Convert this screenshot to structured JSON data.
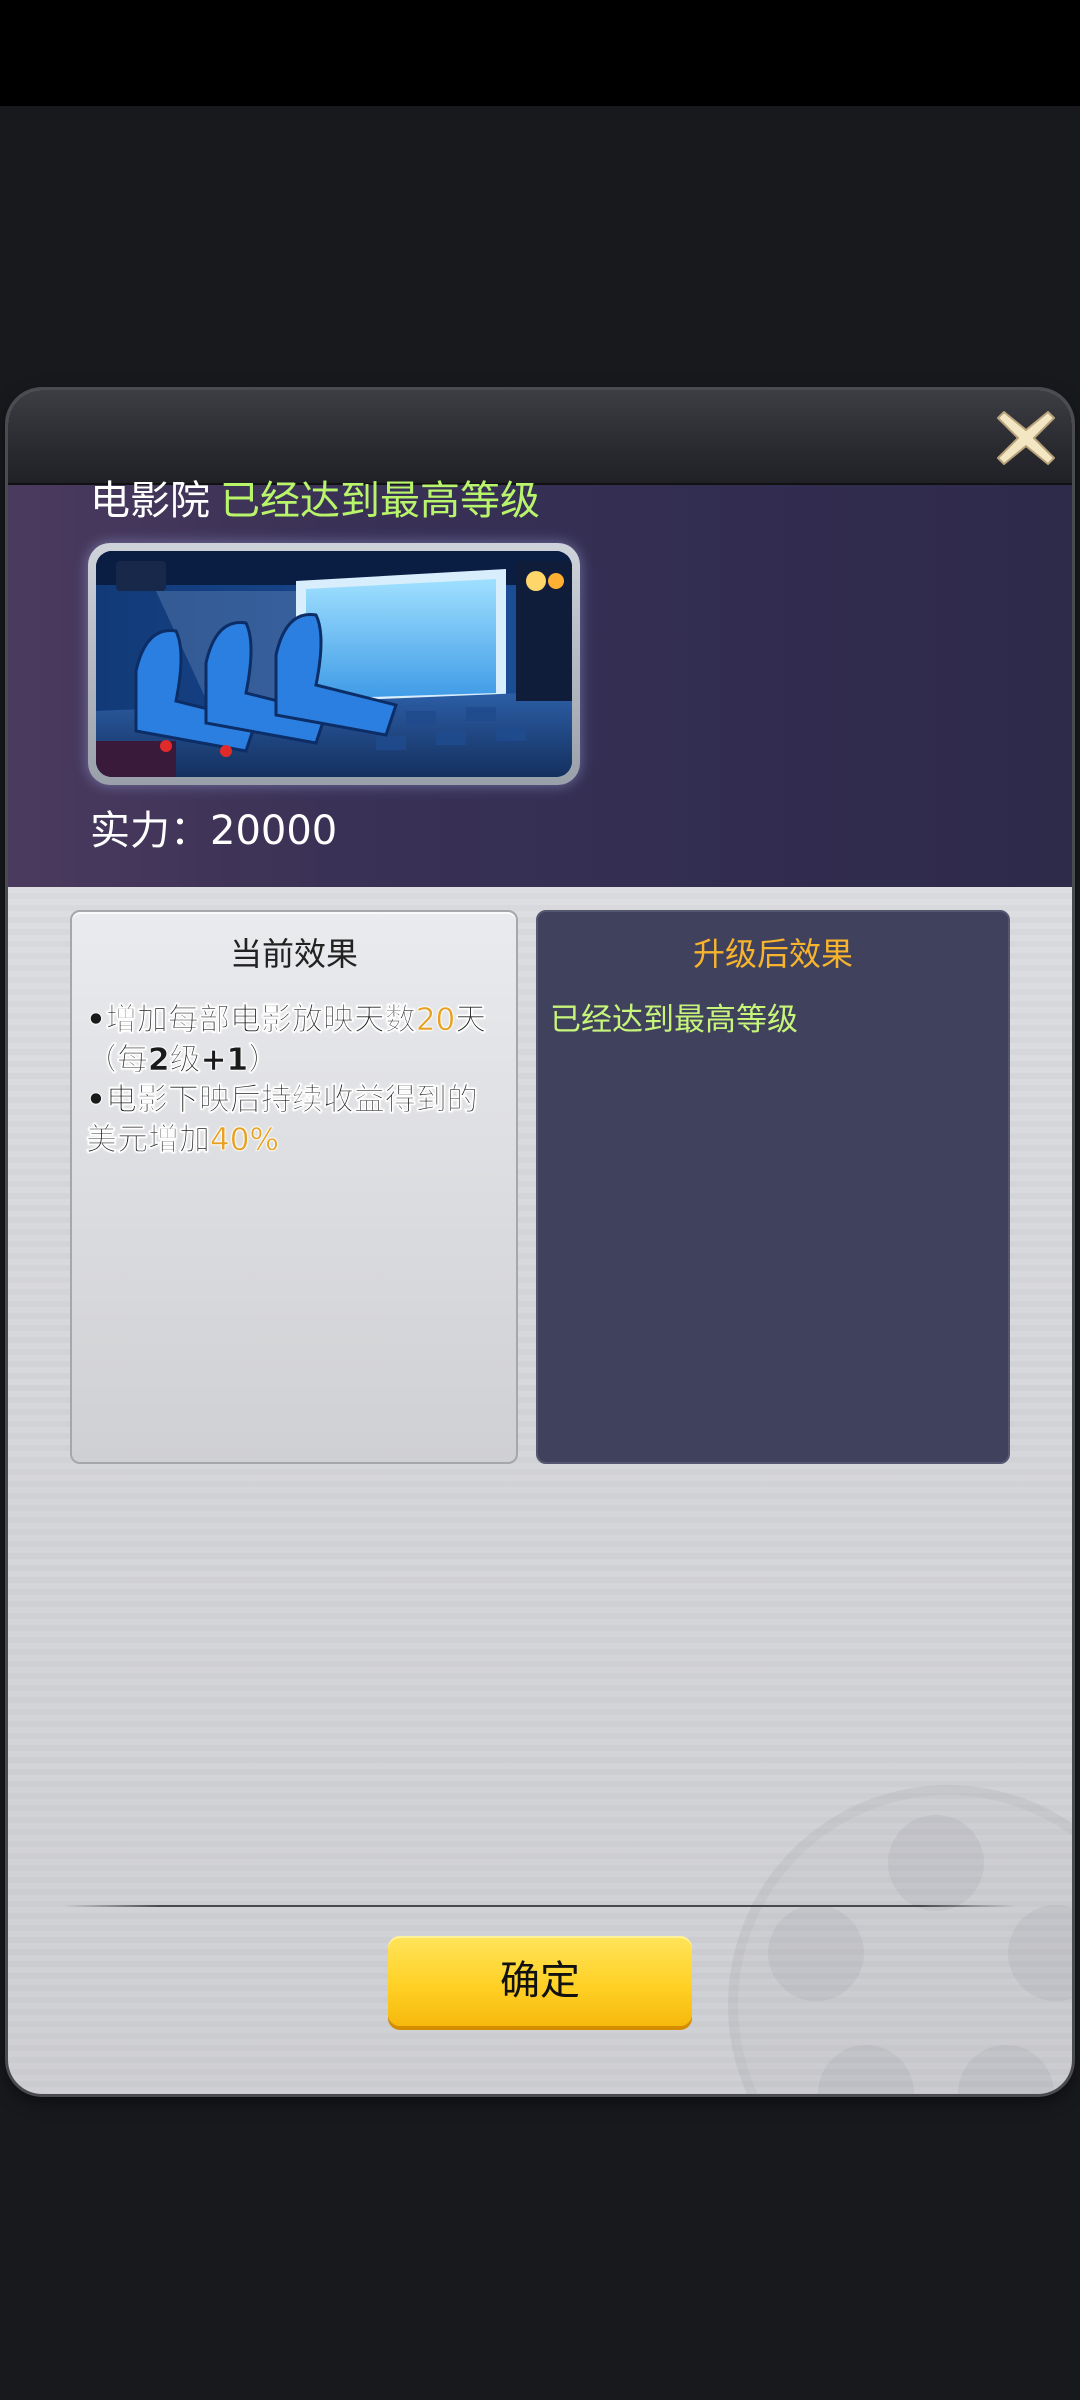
{
  "building": {
    "name": "电影院",
    "level_status": "已经达到最高等级",
    "power_label": "实力：",
    "power_value": "20000"
  },
  "current_panel": {
    "title": "当前效果",
    "effect1_prefix": "•增加每部电影放映天数",
    "effect1_value": "20",
    "effect1_suffix": "天（每2级+1）",
    "effect2_prefix": "•电影下映后持续收益得到的美元增加",
    "effect2_value": "40%"
  },
  "next_panel": {
    "title": "升级后效果",
    "text": "已经达到最高等级"
  },
  "buttons": {
    "confirm_label": "确定"
  },
  "icons": {
    "close": "close-icon",
    "cinema": "cinema-thumbnail",
    "reel": "film-reel-icon"
  },
  "colors": {
    "accent_green": "#b9f56a",
    "accent_orange": "#f7b42c",
    "highlight_value": "#e7a020",
    "confirm_yellow": "#ffd126"
  }
}
